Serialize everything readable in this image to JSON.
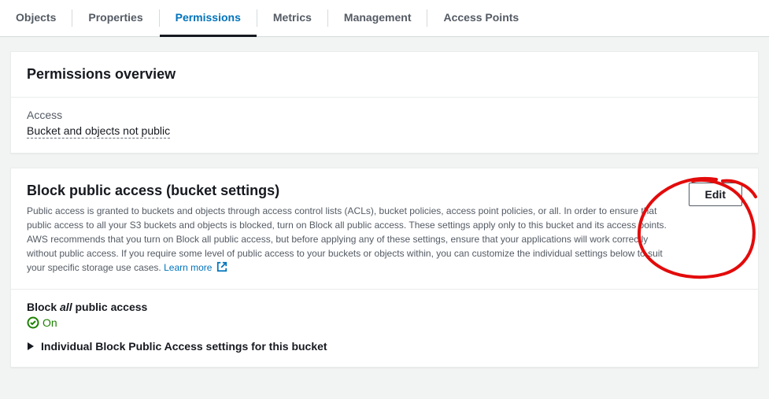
{
  "tabs": [
    {
      "label": "Objects"
    },
    {
      "label": "Properties"
    },
    {
      "label": "Permissions",
      "active": true
    },
    {
      "label": "Metrics"
    },
    {
      "label": "Management"
    },
    {
      "label": "Access Points"
    }
  ],
  "overview": {
    "title": "Permissions overview",
    "access_label": "Access",
    "access_value": "Bucket and objects not public"
  },
  "block_public": {
    "title": "Block public access (bucket settings)",
    "edit_label": "Edit",
    "description": "Public access is granted to buckets and objects through access control lists (ACLs), bucket policies, access point policies, or all. In order to ensure that public access to all your S3 buckets and objects is blocked, turn on Block all public access. These settings apply only to this bucket and its access points. AWS recommends that you turn on Block all public access, but before applying any of these settings, ensure that your applications will work correctly without public access. If you require some level of public access to your buckets or objects within, you can customize the individual settings below to suit your specific storage use cases. ",
    "learn_more": "Learn more",
    "block_all_prefix": "Block ",
    "block_all_em": "all",
    "block_all_suffix": " public access",
    "on_label": "On",
    "expand_label": "Individual Block Public Access settings for this bucket"
  }
}
